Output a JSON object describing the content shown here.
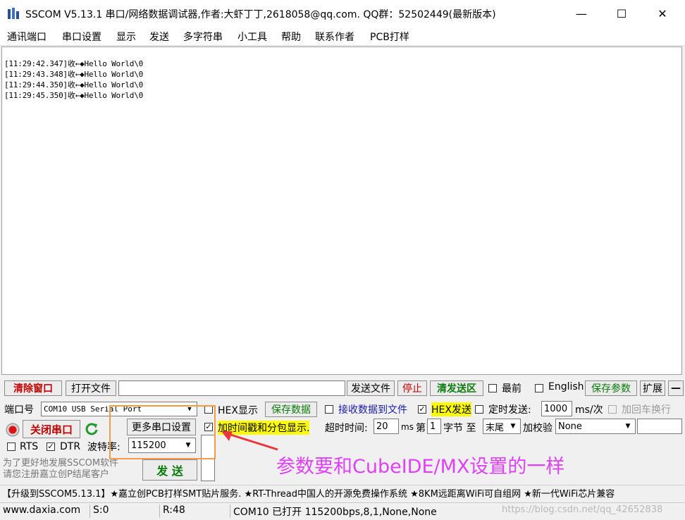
{
  "window": {
    "title": "SSCOM V5.13.1 串口/网络数据调试器,作者:大虾丁丁,2618058@qq.com. QQ群：52502449(最新版本)",
    "minimize": "—",
    "maximize": "☐",
    "close": "✕"
  },
  "menu": [
    "通讯端口",
    "串口设置",
    "显示",
    "发送",
    "多字符串",
    "小工具",
    "帮助",
    "联系作者",
    "PCB打样"
  ],
  "receive": {
    "lines": [
      "[11:29:42.347]收←◆Hello World\\0",
      "[11:29:43.348]收←◆Hello World\\0",
      "[11:29:44.350]收←◆Hello World\\0",
      "[11:29:45.350]收←◆Hello World\\0"
    ]
  },
  "toolbar": {
    "clear_window": "清除窗口",
    "open_file": "打开文件",
    "send_file": "发送文件",
    "stop": "停止",
    "clear_send": "清发送区",
    "topmost": "最前",
    "english": "English",
    "save_params": "保存参数",
    "expand": "扩展",
    "collapse": "—"
  },
  "port": {
    "port_label": "端口号",
    "port_value": "COM10 USB Serial Port",
    "close_port": "关闭串口",
    "more_settings": "更多串口设置",
    "rts": "RTS",
    "dtr": "DTR",
    "baud_label": "波特率:",
    "baud_value": "115200",
    "promo_line1": "为了更好地发展SSCOM软件",
    "promo_line2": "请您注册嘉立创P结尾客户",
    "send_button": "发  送"
  },
  "options": {
    "hex_display": "HEX显示",
    "save_data": "保存数据",
    "recv_to_file": "接收数据到文件",
    "hex_send": "HEX发送",
    "timed_send": "定时发送:",
    "timed_value": "1000",
    "timed_unit": "ms/次",
    "add_crlf": "加回车换行",
    "add_timestamp": "加时间戳和分包显示.",
    "timeout_label": "超时时间:",
    "timeout_value": "20",
    "timeout_unit": "ms",
    "byte_prefix": "第",
    "byte_value": "1",
    "byte_suffix": "字节 至",
    "byte_end": "末尾",
    "checksum_label": "加校验",
    "checksum_value": "None"
  },
  "ticker": "【升级到SSCOM5.13.1】★嘉立创PCB打样SMT贴片服务. ★RT-Thread中国人的开源免费操作系统 ★8KM远距离WiFi可自组网 ★新一代WiFi芯片兼容",
  "status": {
    "website": "www.daxia.com",
    "sent": "S:0",
    "received": "R:48",
    "port_status": "COM10 已打开  115200bps,8,1,None,None",
    "watermark": "https://blog.csdn.net/qq_42652838"
  },
  "annotation": "参数要和CubeIDE/MX设置的一样",
  "colors": {
    "annotation": "#e040fb",
    "highlight_box": "#f39b47",
    "arrow": "#e8383d"
  }
}
